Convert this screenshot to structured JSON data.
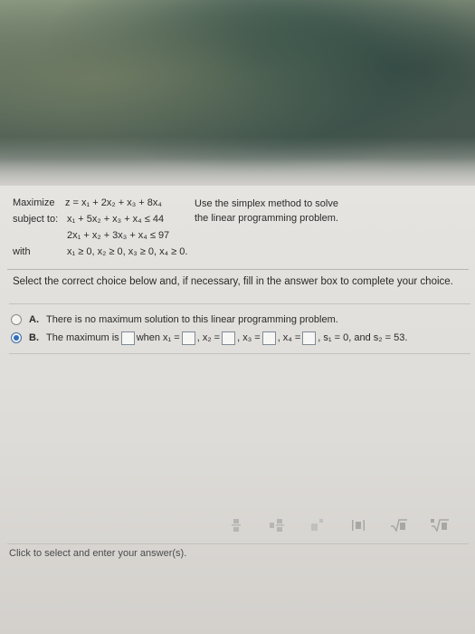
{
  "problem": {
    "maximize_label": "Maximize",
    "objective": "z = x₁ + 2x₂ + x₃ + 8x₄",
    "subject_label": "subject to:",
    "constraint1": "x₁ + 5x₂ + x₃ + x₄ ≤ 44",
    "constraint2": "2x₁ + x₂ + 3x₃ + x₄ ≤ 97",
    "with_label": "with",
    "nonneg": "x₁ ≥ 0, x₂ ≥ 0, x₃ ≥ 0, x₄ ≥ 0."
  },
  "instructions": {
    "line1": "Use the simplex method to solve",
    "line2": "the linear programming problem."
  },
  "prompt": "Select the correct choice below and, if necessary, fill in the answer box to complete your choice.",
  "choices": {
    "a": {
      "letter": "A.",
      "text": "There is no maximum solution to this linear programming problem."
    },
    "b": {
      "letter": "B.",
      "text_start": "The maximum is",
      "when_x1": "when x₁ =",
      "x2": ", x₂ =",
      "x3": ", x₃ =",
      "x4": ", x₄ =",
      "tail": ", s₁ = 0, and s₂ = 53."
    }
  },
  "status": "Click to select and enter your answer(s)."
}
